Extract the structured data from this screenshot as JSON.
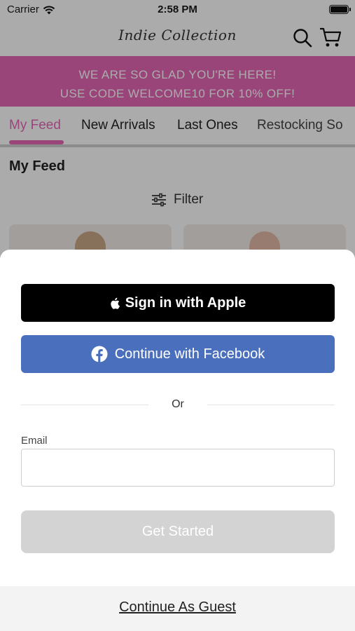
{
  "status_bar": {
    "carrier": "Carrier",
    "time": "2:58 PM",
    "wifi_icon": "wifi-icon",
    "battery_icon": "battery-icon"
  },
  "header": {
    "logo_text": "Indie Collection",
    "search_icon": "search-icon",
    "cart_icon": "cart-icon"
  },
  "promo": {
    "line1": "WE ARE SO GLAD YOU'RE HERE!",
    "line2": "USE CODE WELCOME10 FOR 10% OFF!",
    "color": "#e567b7"
  },
  "tabs": [
    {
      "label": "My Feed",
      "active": true
    },
    {
      "label": "New Arrivals"
    },
    {
      "label": "Last Ones"
    },
    {
      "label": "Restocking So"
    }
  ],
  "feed": {
    "title": "My Feed",
    "filter_label": "Filter",
    "filter_icon": "sliders-icon"
  },
  "sheet": {
    "apple_button": "Sign in with Apple",
    "facebook_button": "Continue with Facebook",
    "or_text": "Or",
    "email_label": "Email",
    "email_value": "",
    "email_placeholder": "",
    "get_started_button": "Get Started",
    "guest_link": "Continue As Guest",
    "colors": {
      "apple_bg": "#000000",
      "facebook_bg": "#4a6fbd",
      "disabled_bg": "#d3d3d3"
    }
  }
}
